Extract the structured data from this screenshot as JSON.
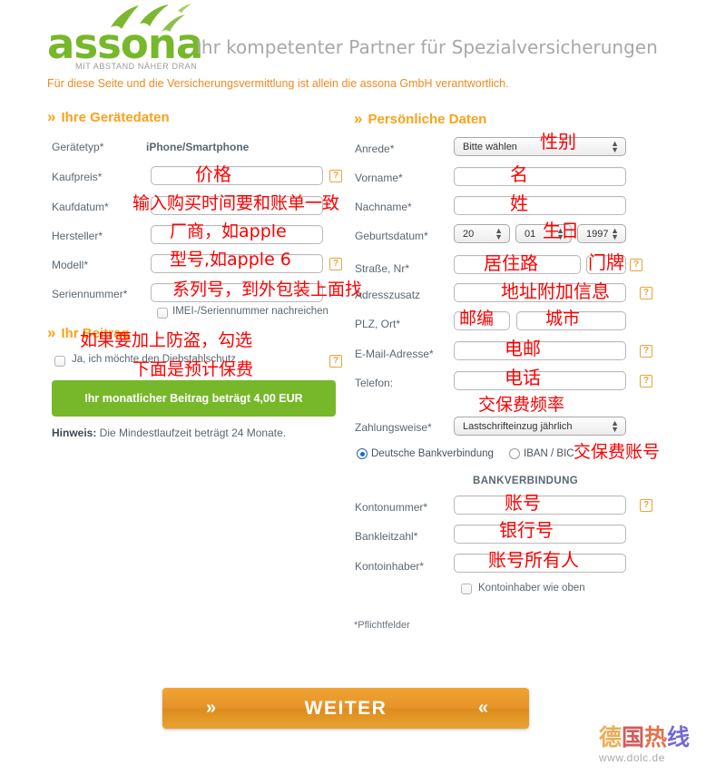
{
  "header": {
    "logo_word": "assona",
    "logo_tagline": "MIT ABSTAND NÄHER DRAN",
    "tagline": "Ihr kompetenter Partner für Spezialversicherungen",
    "disclaimer": "Für diese Seite und die Versicherungsvermittlung ist allein die assona GmbH verantwortlich.",
    "chevron": "»"
  },
  "left_section": {
    "heading": "Ihre Gerätedaten",
    "rows": {
      "geraetetyp_label": "Gerätetyp*",
      "geraetetyp_value": "iPhone/Smartphone",
      "kaufpreis_label": "Kaufpreis*",
      "kaufdatum_label": "Kaufdatum*",
      "hersteller_label": "Hersteller*",
      "modell_label": "Modell*",
      "seriennummer_label": "Seriennummer*"
    },
    "imei_checkbox_label": "IMEI-/Seriennummer nachreichen",
    "beitrag_heading": "Ihr Beitrag",
    "diebstahl_checkbox_label": "Ja, ich möchte den Diebstahlschutz",
    "premium_text": "Ihr monatlicher Beitrag beträgt 4,00 EUR",
    "hinweis_bold": "Hinweis:",
    "hinweis_text": " Die Mindestlaufzeit beträgt 24 Monate."
  },
  "right_section": {
    "heading": "Persönliche Daten",
    "rows": {
      "anrede_label": "Anrede*",
      "anrede_value": "Bitte wählen",
      "vorname_label": "Vorname*",
      "nachname_label": "Nachname*",
      "geburtsdatum_label": "Geburtsdatum*",
      "geburt_day": "20",
      "geburt_month": "01",
      "geburt_year": "1997",
      "strasse_label": "Straße, Nr*",
      "adresszusatz_label": "Adresszusatz",
      "plz_label": "PLZ, Ort*",
      "email_label": "E-Mail-Adresse*",
      "telefon_label": "Telefon:",
      "zahlungsweise_label": "Zahlungsweise*",
      "zahlungsweise_value": "Lastschrifteinzug jährlich"
    },
    "radio_deutsche": "Deutsche Bankverbindung",
    "radio_iban": "IBAN / BIC",
    "bank_title": "BANKVERBINDUNG",
    "kontonummer_label": "Kontonummer*",
    "bankleitzahl_label": "Bankleitzahl*",
    "kontoinhaber_label": "Kontoinhaber*",
    "kontoinhaber_checkbox_label": "Kontoinhaber wie oben",
    "pflichtfelder": "*Pflichtfelder"
  },
  "submit": {
    "label": "WEITER",
    "left_chevron": "»",
    "right_chevron": "«"
  },
  "annotations": {
    "preis": "价格",
    "kaufdatum": "输入购买时间要和账单一致",
    "hersteller": "厂商，如apple",
    "modell": "型号,如apple 6",
    "seriennummer": "系列号，到外包装上面找",
    "diebstahl": "如果要加上防盗，勾选",
    "premium_note": "下面是预计保费",
    "anrede": "性别",
    "vorname": "名",
    "nachname": "姓",
    "geburtsdatum": "生日",
    "strasse": "居住路",
    "hausnummer": "门牌",
    "adresszusatz": "地址附加信息",
    "plz": "邮编",
    "ort": "城市",
    "email": "电邮",
    "telefon": "电话",
    "zahlungsweise": "交保费频率",
    "bankkonto": "交保费账号",
    "kontonummer": "账号",
    "bankleitzahl": "银行号",
    "kontoinhaber": "账号所有人"
  },
  "watermark": {
    "cn1": "德",
    "cn2": "国",
    "cn3": "热",
    "cn4": "线",
    "url": "www.dolc.de"
  },
  "colors": {
    "orange_heading": "#faa21b",
    "orange_disclaimer": "#f08a1e",
    "green_logo": "#76b82a",
    "green_premium": "#76b82a",
    "annotation_red": "#fe0000",
    "button_orange": "#e6942a"
  },
  "icons": {
    "help": "?",
    "select_arrows": "↕"
  }
}
